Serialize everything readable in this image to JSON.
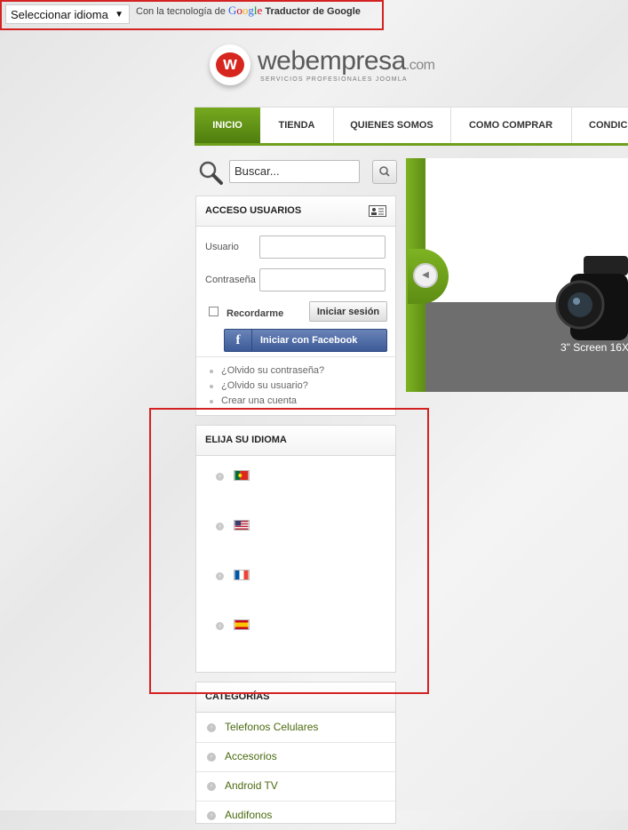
{
  "translate_bar": {
    "select_value": "Seleccionar idioma",
    "powered_prefix": "Con la tecnología de",
    "google_word": "Google",
    "powered_product": "Traductor de Google"
  },
  "logo": {
    "mark": "w",
    "name": "webempresa",
    "domain": ".com",
    "tagline": "SERVICIOS PROFESIONALES JOOMLA"
  },
  "nav": {
    "items": [
      {
        "label": "INICIO"
      },
      {
        "label": "TIENDA"
      },
      {
        "label": "QUIENES SOMOS"
      },
      {
        "label": "COMO COMPRAR"
      },
      {
        "label": "CONDIC"
      }
    ]
  },
  "search": {
    "placeholder": "Buscar..."
  },
  "login": {
    "title": "ACCESO USUARIOS",
    "username_label": "Usuario",
    "password_label": "Contraseña",
    "remember_label": "Recordarme",
    "login_button": "Iniciar sesión",
    "facebook_icon": "f",
    "facebook_button": "Iniciar con Facebook",
    "links": [
      "¿Olvido su contraseña?",
      "¿Olvido su usuario?",
      "Crear una cuenta"
    ]
  },
  "language": {
    "title": "ELIJA SU IDIOMA",
    "flags": [
      "portugal-flag-icon",
      "usa-flag-icon",
      "france-flag-icon",
      "spain-flag-icon"
    ]
  },
  "categories": {
    "title": "CATEGORÍAS",
    "items": [
      "Telefonos Celulares",
      "Accesorios",
      "Android TV",
      "Audifonos"
    ]
  },
  "slider": {
    "caption": "3\" Screen 16X",
    "prev_icon": "chevron-left-icon"
  },
  "colors": {
    "accent_green": "#6ea01d",
    "highlight_red": "#d42222",
    "facebook_blue": "#3d5a98"
  }
}
